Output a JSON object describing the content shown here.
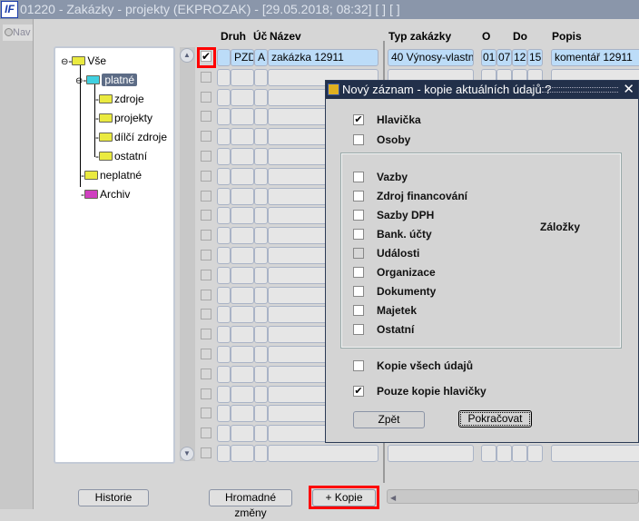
{
  "window": {
    "title": "01220 - Zakázky - projekty (EKPROZAK) - [29.05.2018; 08:32]  [ ]  [ ]",
    "logo": "IF"
  },
  "nav": {
    "label": "Nav"
  },
  "tree": {
    "root": "Vše",
    "valid": "platné",
    "children": [
      "zdroje",
      "projekty",
      "dílčí zdroje",
      "ostatní"
    ],
    "invalid": "neplatné",
    "archive": "Archiv"
  },
  "table": {
    "headers": {
      "druh": "Druh",
      "uc": "Úč",
      "nazev": "Název",
      "typ": "Typ zakázky",
      "o": "O",
      "do": "Do",
      "popis": "Popis"
    },
    "row": {
      "checked": true,
      "blank": "",
      "druh": "PZD",
      "uc": "A",
      "nazev": "zakázka 12911",
      "typ": "40 Výnosy-vlastní",
      "o1": "01",
      "o2": "07",
      "d1": "12",
      "d2": "15",
      "popis": "komentář 12911"
    },
    "empty_rows": 21
  },
  "buttons": {
    "historie": "Historie",
    "hromadne": "Hromadné změny",
    "kopie": "+ Kopie"
  },
  "dialog": {
    "title": "Nový záznam - kopie aktuálních údajů ?",
    "close": "✕",
    "hlavicka": {
      "label": "Hlavička",
      "checked": true
    },
    "osoby": {
      "label": "Osoby",
      "checked": false
    },
    "group_label": "Záložky",
    "tabs": [
      {
        "label": "Vazby",
        "checked": false
      },
      {
        "label": "Zdroj financování",
        "checked": false
      },
      {
        "label": "Sazby DPH",
        "checked": false
      },
      {
        "label": "Bank. účty",
        "checked": false
      },
      {
        "label": "Události",
        "checked": false,
        "disabled": true
      },
      {
        "label": "Organizace",
        "checked": false
      },
      {
        "label": "Dokumenty",
        "checked": false
      },
      {
        "label": "Majetek",
        "checked": false
      },
      {
        "label": "Ostatní",
        "checked": false
      }
    ],
    "kopie_vse": {
      "label": "Kopie všech údajů",
      "checked": false
    },
    "pouze_hlavicka": {
      "label": "Pouze kopie hlavičky",
      "checked": true
    },
    "back": "Zpět",
    "continue": "Pokračovat"
  },
  "colors": {
    "title": "#8a96aa",
    "dialog_title": "#22304a",
    "active_row": "#bcdcf8",
    "highlight": "#ff0000"
  }
}
